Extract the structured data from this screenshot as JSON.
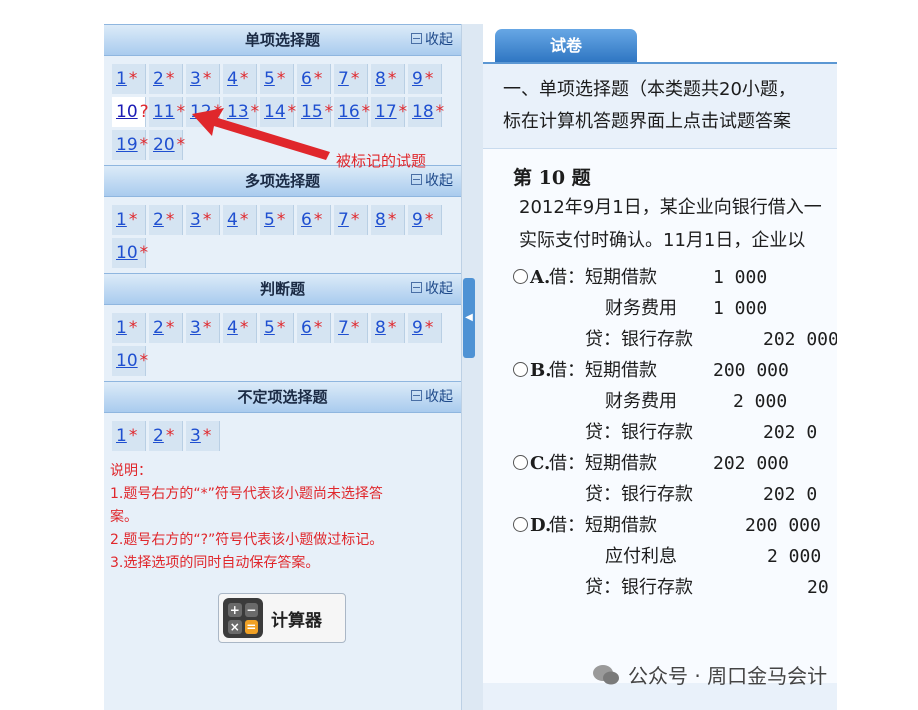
{
  "sections": [
    {
      "title": "单项选择题",
      "collapse": "收起",
      "questions": [
        {
          "n": "1",
          "m": "*"
        },
        {
          "n": "2",
          "m": "*"
        },
        {
          "n": "3",
          "m": "*"
        },
        {
          "n": "4",
          "m": "*"
        },
        {
          "n": "5",
          "m": "*"
        },
        {
          "n": "6",
          "m": "*"
        },
        {
          "n": "7",
          "m": "*"
        },
        {
          "n": "8",
          "m": "*"
        },
        {
          "n": "9",
          "m": "*"
        },
        {
          "n": "10",
          "m": "?"
        },
        {
          "n": "11",
          "m": "*"
        },
        {
          "n": "12",
          "m": "*"
        },
        {
          "n": "13",
          "m": "*"
        },
        {
          "n": "14",
          "m": "*"
        },
        {
          "n": "15",
          "m": "*"
        },
        {
          "n": "16",
          "m": "*"
        },
        {
          "n": "17",
          "m": "*"
        },
        {
          "n": "18",
          "m": "*"
        },
        {
          "n": "19",
          "m": "*"
        },
        {
          "n": "20",
          "m": "*"
        }
      ]
    },
    {
      "title": "多项选择题",
      "collapse": "收起",
      "questions": [
        {
          "n": "1",
          "m": "*"
        },
        {
          "n": "2",
          "m": "*"
        },
        {
          "n": "3",
          "m": "*"
        },
        {
          "n": "4",
          "m": "*"
        },
        {
          "n": "5",
          "m": "*"
        },
        {
          "n": "6",
          "m": "*"
        },
        {
          "n": "7",
          "m": "*"
        },
        {
          "n": "8",
          "m": "*"
        },
        {
          "n": "9",
          "m": "*"
        },
        {
          "n": "10",
          "m": "*"
        }
      ]
    },
    {
      "title": "判断题",
      "collapse": "收起",
      "questions": [
        {
          "n": "1",
          "m": "*"
        },
        {
          "n": "2",
          "m": "*"
        },
        {
          "n": "3",
          "m": "*"
        },
        {
          "n": "4",
          "m": "*"
        },
        {
          "n": "5",
          "m": "*"
        },
        {
          "n": "6",
          "m": "*"
        },
        {
          "n": "7",
          "m": "*"
        },
        {
          "n": "8",
          "m": "*"
        },
        {
          "n": "9",
          "m": "*"
        },
        {
          "n": "10",
          "m": "*"
        }
      ]
    },
    {
      "title": "不定项选择题",
      "collapse": "收起",
      "questions": [
        {
          "n": "1",
          "m": "*"
        },
        {
          "n": "2",
          "m": "*"
        },
        {
          "n": "3",
          "m": "*"
        }
      ]
    }
  ],
  "notes": {
    "title": "说明：",
    "line1": "1.题号右方的“*”符号代表该小题尚未选择答",
    "line1b": "案。",
    "line2": "2.题号右方的“?”符号代表该小题做过标记。",
    "line3": "3.选择选项的同时自动保存答案。"
  },
  "calculator": {
    "label": "计算器"
  },
  "annotation": {
    "text": "被标记的试题"
  },
  "tab": {
    "label": "试卷"
  },
  "intro": {
    "line1": "一、单项选择题（本类题共20小题，",
    "line2": "标在计算机答题界面上点击试题答案"
  },
  "question": {
    "title": "第 10 题",
    "text1": "2012年9月1日，某企业向银行借入一",
    "text2": "实际支付时确认。11月1日，企业以",
    "options": [
      {
        "letter": "A.",
        "rows": [
          {
            "a": "借：短期借款",
            "b": "1 000"
          },
          {
            "a": "财务费用",
            "b": "1 000"
          },
          {
            "a": "贷：银行存款",
            "b": "202 000"
          }
        ]
      },
      {
        "letter": "B.",
        "rows": [
          {
            "a": "借：短期借款",
            "b": "200 000"
          },
          {
            "a": "财务费用",
            "b": "2 000"
          },
          {
            "a": "贷：银行存款",
            "b": "202 0"
          }
        ]
      },
      {
        "letter": "C.",
        "rows": [
          {
            "a": "借：短期借款",
            "b": "202 000"
          },
          {
            "a": "贷：银行存款",
            "b": "202 0"
          }
        ]
      },
      {
        "letter": "D.",
        "rows": [
          {
            "a": "借：短期借款",
            "b": "200 000"
          },
          {
            "a": "应付利息",
            "b": "2 000"
          },
          {
            "a": "贷：银行存款",
            "b": "20"
          }
        ]
      }
    ]
  },
  "watermark": {
    "text": "公众号 · 周口金马会计"
  },
  "colors": {
    "accent": "#2f76c2",
    "marker": "#e0272c",
    "link": "#1f4fd0"
  }
}
